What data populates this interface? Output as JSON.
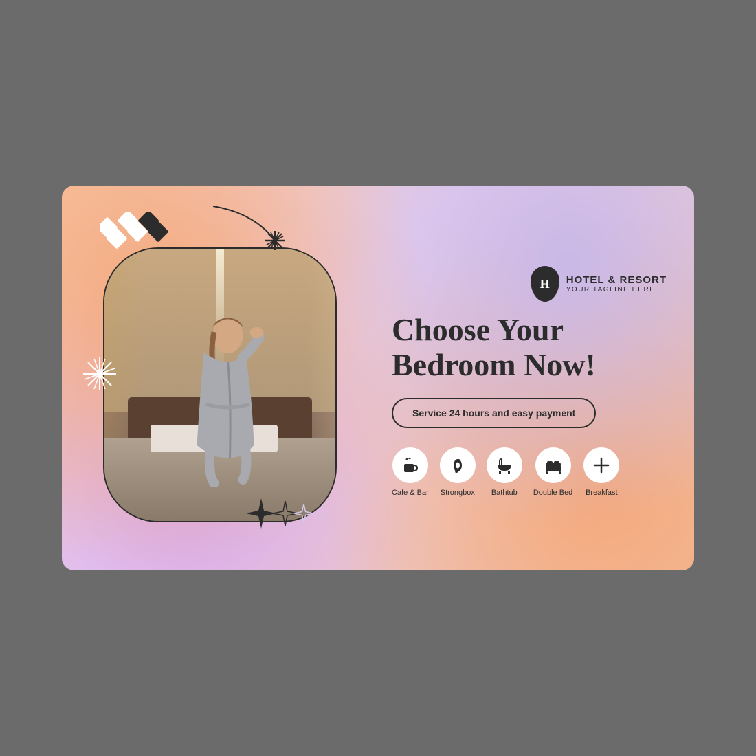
{
  "card": {
    "background": "gradient"
  },
  "logo": {
    "icon_letter": "H",
    "title": "HOTEL & RESORT",
    "tagline": "YOUR TAGLINE HERE"
  },
  "hero": {
    "heading_line1": "Choose Your",
    "heading_line2": "Bedroom Now!",
    "service_btn": "Service 24 hours and easy payment"
  },
  "amenities": [
    {
      "icon": "☕",
      "label": "Cafe & Bar"
    },
    {
      "icon": "🗝",
      "label": "Strongbox"
    },
    {
      "icon": "🛁",
      "label": "Bathtub"
    },
    {
      "icon": "🛏",
      "label": "Double Bed"
    },
    {
      "icon": "✖",
      "label": "Breakfast"
    }
  ],
  "decorations": {
    "diamond_colors": [
      "white",
      "dark",
      "white",
      "white",
      "dark",
      "white",
      "white",
      "dark"
    ]
  }
}
